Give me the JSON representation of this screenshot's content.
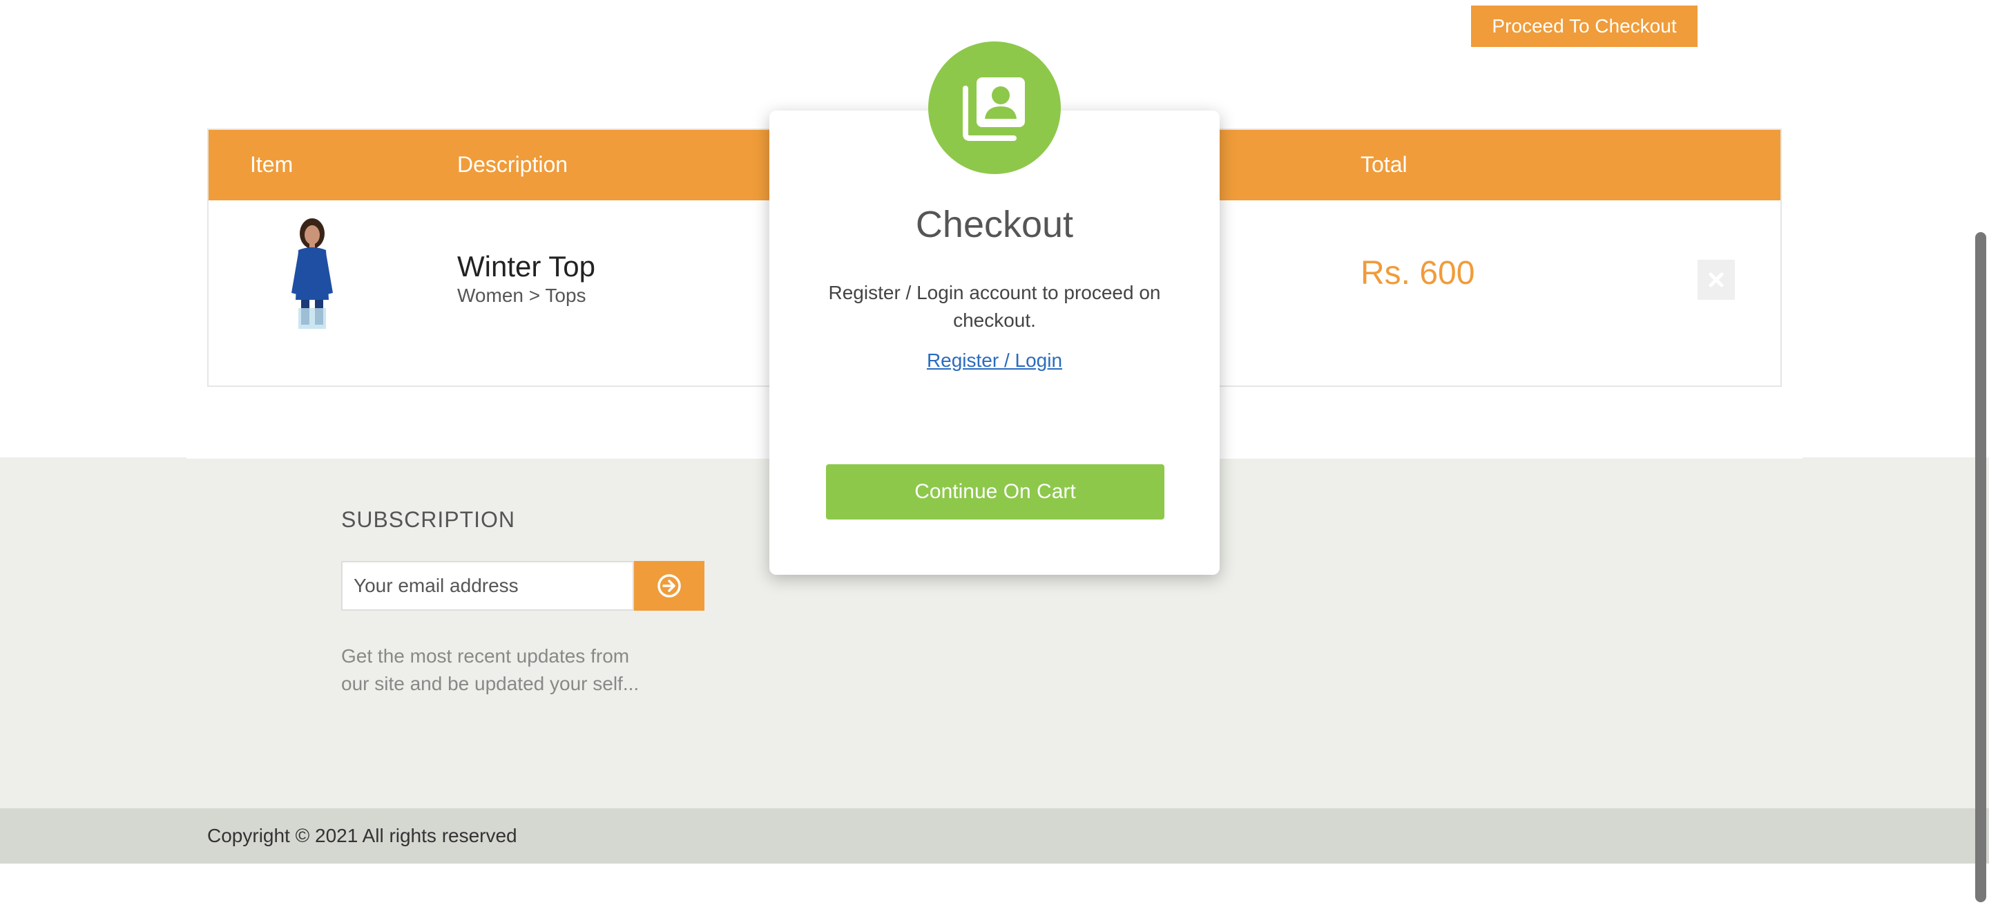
{
  "header": {
    "proceed_label": "Proceed To Checkout"
  },
  "cart": {
    "columns": {
      "item": "Item",
      "description": "Description",
      "total": "Total"
    },
    "rows": [
      {
        "name": "Winter Top",
        "category": "Women > Tops",
        "total": "Rs. 600"
      }
    ]
  },
  "modal": {
    "title": "Checkout",
    "message": "Register / Login account to proceed on checkout.",
    "link_label": "Register / Login",
    "continue_label": "Continue On Cart"
  },
  "subscription": {
    "title": "SUBSCRIPTION",
    "placeholder": "Your email address",
    "description": "Get the most recent updates from our site and be updated your self..."
  },
  "footer": {
    "copyright": "Copyright © 2021 All rights reserved"
  },
  "colors": {
    "accent": "#f09c3a",
    "modal_green": "#8dc84b",
    "link": "#2a6bbf"
  },
  "icons": {
    "modal": "contact-book-icon",
    "subscribe": "arrow-circle-right-icon",
    "remove": "close-icon"
  }
}
